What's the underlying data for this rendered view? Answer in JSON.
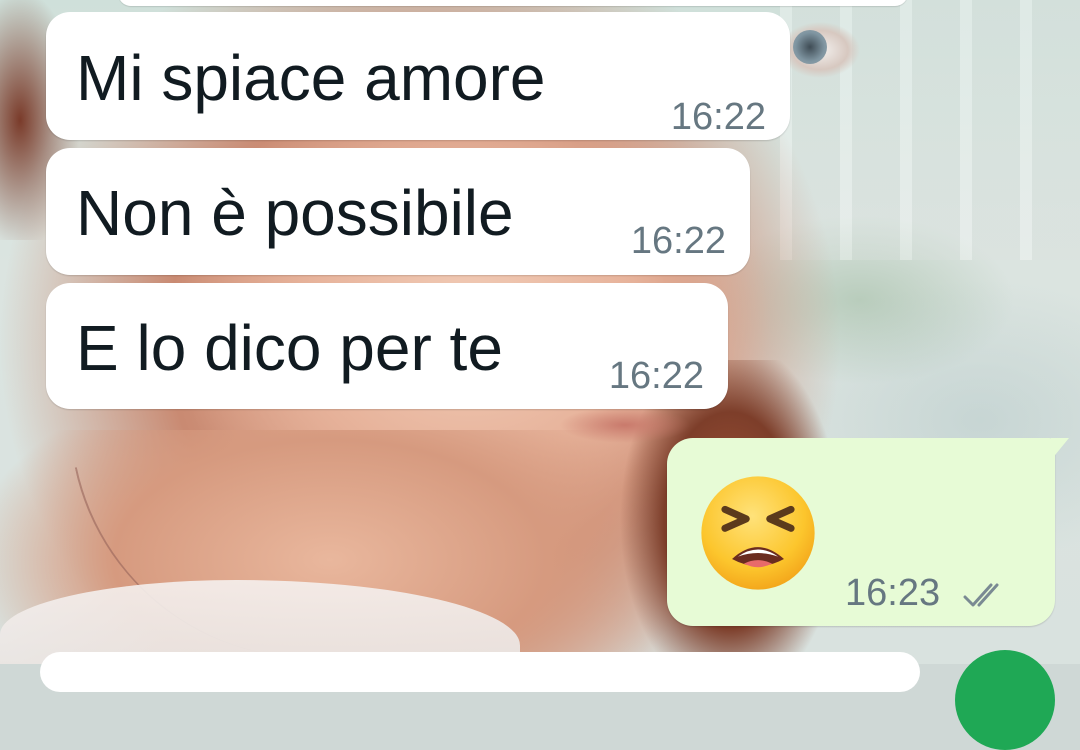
{
  "chat": {
    "incoming": [
      {
        "text": "Mi spiace amore",
        "time": "16:22"
      },
      {
        "text": "Non è possibile",
        "time": "16:22"
      },
      {
        "text": "E lo dico per te",
        "time": "16:22"
      }
    ],
    "outgoing": {
      "emoji": "tired-face-emoji",
      "time": "16:23",
      "status": "read-double-check-icon"
    }
  },
  "colors": {
    "incoming_bubble": "#ffffff",
    "outgoing_bubble": "#e7fbd6",
    "timestamp": "#667781",
    "send_button": "#1fa855"
  }
}
